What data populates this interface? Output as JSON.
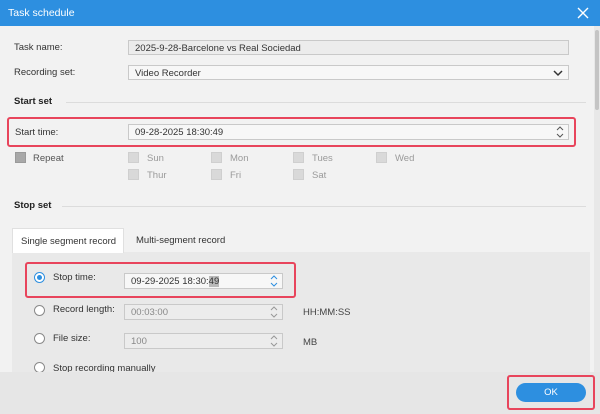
{
  "window": {
    "title": "Task schedule"
  },
  "task": {
    "name_label": "Task name:",
    "name_value": "2025-9-28-Barcelone vs Real Sociedad",
    "recording_set_label": "Recording set:",
    "recording_set_value": "Video Recorder"
  },
  "start_set": {
    "title": "Start set",
    "start_time_label": "Start time:",
    "start_time_value": "09-28-2025 18:30:49",
    "repeat_label": "Repeat",
    "days": {
      "sun": "Sun",
      "mon": "Mon",
      "tues": "Tues",
      "wed": "Wed",
      "thur": "Thur",
      "fri": "Fri",
      "sat": "Sat"
    }
  },
  "stop_set": {
    "title": "Stop set",
    "tabs": {
      "single": "Single segment record",
      "multi": "Multi-segment record"
    },
    "stop_time_label": "Stop time:",
    "stop_time_value_main": "09-29-2025 18:30:",
    "stop_time_value_sel": "49",
    "record_length_label": "Record length:",
    "record_length_value": "00:03:00",
    "record_length_unit": "HH:MM:SS",
    "file_size_label": "File size:",
    "file_size_value": "100",
    "file_size_unit": "MB",
    "manual_label": "Stop recording manually"
  },
  "footer": {
    "ok_label": "OK"
  },
  "colors": {
    "accent": "#2d8fe0",
    "highlight": "#e8455c"
  }
}
